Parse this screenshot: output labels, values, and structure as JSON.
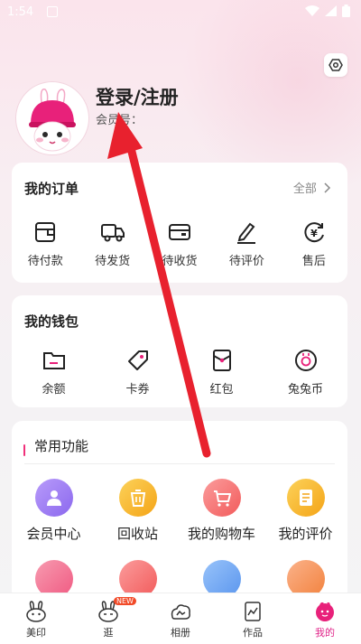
{
  "status_bar": {
    "time": "1:54"
  },
  "profile": {
    "login_label": "登录/注册",
    "member_label": "会员号："
  },
  "orders": {
    "title": "我的订单",
    "all_label": "全部",
    "items": [
      {
        "label": "待付款",
        "icon": "wallet-icon"
      },
      {
        "label": "待发货",
        "icon": "truck-icon"
      },
      {
        "label": "待收货",
        "icon": "box-icon"
      },
      {
        "label": "待评价",
        "icon": "pen-icon"
      },
      {
        "label": "售后",
        "icon": "refund-icon"
      }
    ]
  },
  "wallet": {
    "title": "我的钱包",
    "items": [
      {
        "label": "余额",
        "icon": "folder-icon"
      },
      {
        "label": "卡券",
        "icon": "tag-icon"
      },
      {
        "label": "红包",
        "icon": "red-packet-icon"
      },
      {
        "label": "兔兔币",
        "icon": "coin-icon"
      }
    ]
  },
  "functions": {
    "title": "常用功能",
    "items": [
      {
        "label": "会员中心",
        "color": "#9b7cf0",
        "icon": "member-icon"
      },
      {
        "label": "回收站",
        "color": "#f7b22c",
        "icon": "recycle-bin-icon"
      },
      {
        "label": "我的购物车",
        "color": "#f46f6f",
        "icon": "cart-icon"
      },
      {
        "label": "我的评价",
        "color": "#f7b22c",
        "icon": "review-icon"
      }
    ],
    "row2_colors": [
      "#f3718f",
      "#f46f6f",
      "#6aa6f2",
      "#f6925a"
    ]
  },
  "tabs": [
    {
      "label": "美印",
      "icon": "bunny-icon"
    },
    {
      "label": "逛",
      "icon": "bunny-shop-icon",
      "badge": "NEW"
    },
    {
      "label": "相册",
      "icon": "album-icon"
    },
    {
      "label": "作品",
      "icon": "works-icon"
    },
    {
      "label": "我的",
      "icon": "mine-icon",
      "active": true
    }
  ],
  "colors": {
    "accent": "#e0258a",
    "arrow": "#e8212e"
  }
}
